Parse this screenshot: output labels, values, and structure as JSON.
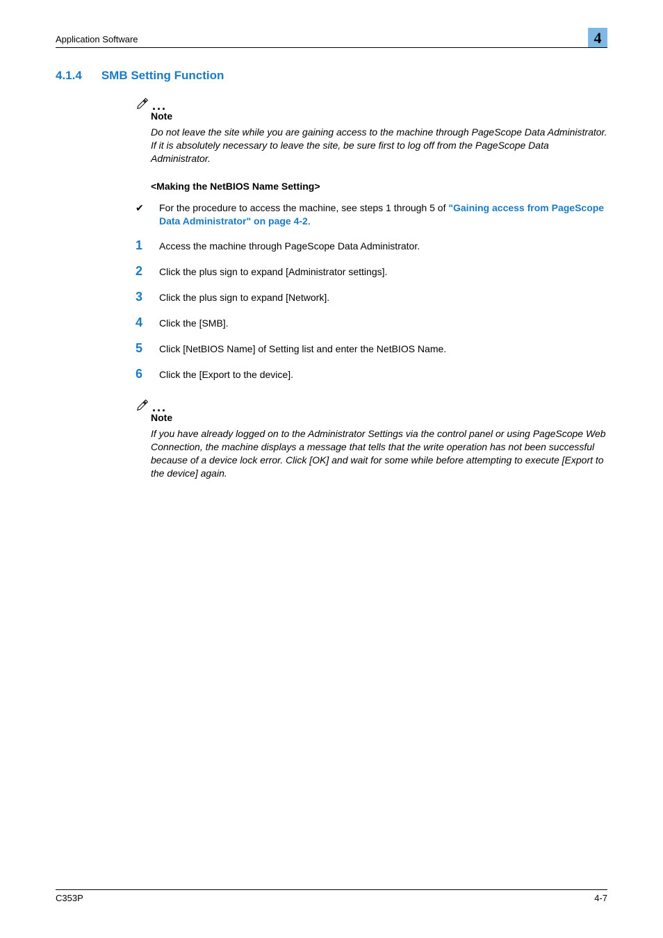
{
  "header": {
    "title": "Application Software",
    "chapter_number": "4"
  },
  "section": {
    "number": "4.1.4",
    "title": "SMB Setting Function"
  },
  "note1": {
    "label": "Note",
    "body": "Do not leave the site while you are gaining access to the machine through PageScope Data Administrator. If it is absolutely necessary to leave the site, be sure first to log off from the PageScope Data Administrator."
  },
  "subheading": "<Making the NetBIOS Name Setting>",
  "bullet": {
    "mark": "✔",
    "text_before": "For the procedure to access the machine, see steps 1 through 5 of ",
    "link_text": "\"Gaining access from PageScope Data Administrator\" on page 4-2",
    "text_after": "."
  },
  "steps": [
    {
      "num": "1",
      "text": "Access the machine through PageScope Data Administrator."
    },
    {
      "num": "2",
      "text": "Click the plus sign to expand [Administrator settings]."
    },
    {
      "num": "3",
      "text": "Click the plus sign to expand [Network]."
    },
    {
      "num": "4",
      "text": "Click the [SMB]."
    },
    {
      "num": "5",
      "text": "Click [NetBIOS Name] of Setting list and enter the NetBIOS Name."
    },
    {
      "num": "6",
      "text": "Click the [Export to the device]."
    }
  ],
  "note2": {
    "label": "Note",
    "body": "If you have already logged on to the Administrator Settings via the control panel or using PageScope Web Connection, the machine displays a message that tells that the write operation has not been successful because of a device lock error. Click [OK] and wait for some while before attempting to execute [Export to the device] again."
  },
  "footer": {
    "model": "C353P",
    "page": "4-7"
  }
}
